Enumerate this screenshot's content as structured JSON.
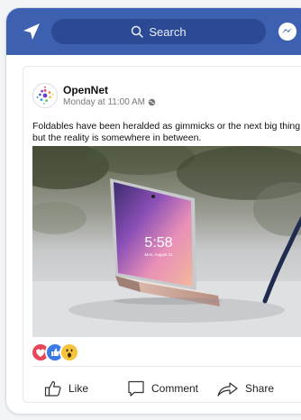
{
  "topbar": {
    "search_label": "Search",
    "bar_color": "#3d60b1",
    "pill_color": "#2c4a93"
  },
  "post": {
    "author": "OpenNet",
    "timestamp": "Monday at 11:00 AM",
    "privacy_icon": "globe-icon",
    "text": "Foldables have been heralded as gimmicks or the next big thing, but the reality is somewhere in between.",
    "image": {
      "clock": "5:58",
      "date": "Mon, August 11"
    },
    "reactions": [
      "love",
      "like",
      "wow"
    ]
  },
  "actions": {
    "like_label": "Like",
    "comment_label": "Comment",
    "share_label": "Share"
  }
}
